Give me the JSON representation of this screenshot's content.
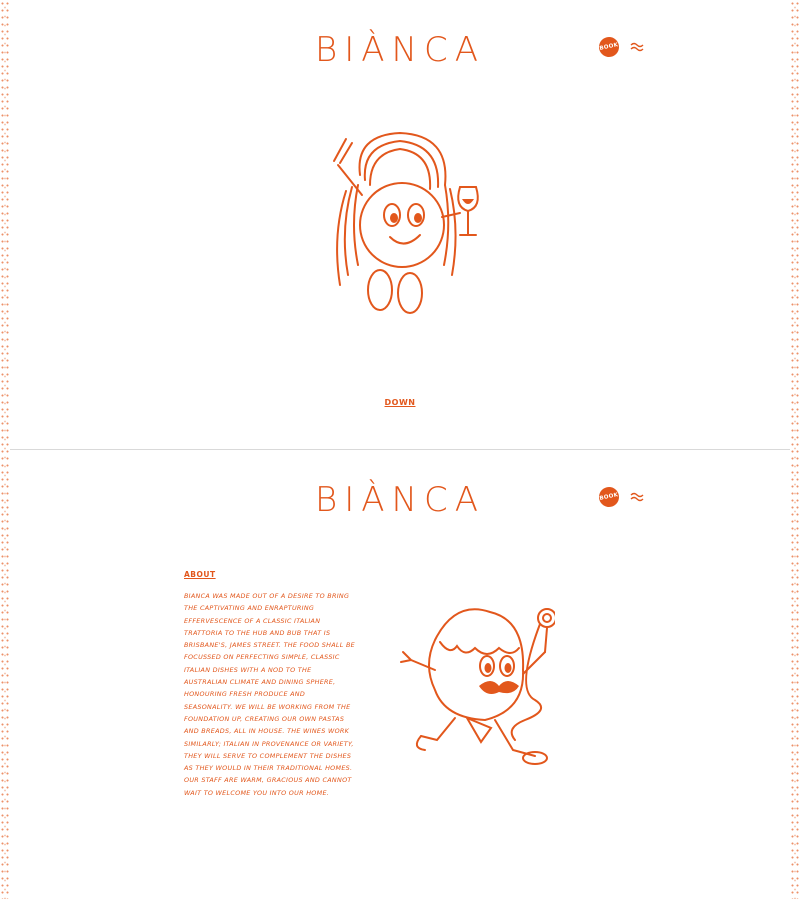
{
  "brand": {
    "logo_text": "BIÀNCA",
    "accent": "#e2571c"
  },
  "header": {
    "book_label": "BOOK",
    "menu_icon": "wave-menu-icon"
  },
  "hero": {
    "down_label": "DOWN",
    "illustration": "spaghetti-character-with-wine"
  },
  "about": {
    "heading": "ABOUT",
    "body": "Bianca was made out of a desire to bring the captivating and enrapturing effervescence of a classic Italian trattoria to the hub and bub that is Brisbane's, James Street. The food shall be focussed on perfecting simple, classic Italian dishes with a nod to the Australian climate and dining sphere, honouring fresh produce and seasonality. We will be working from the foundation up, creating our own pastas and breads, all in house. The wines work similarly; Italian in provenance or variety, they will serve to complement the dishes as they would in their traditional homes. Our staff are warm, gracious and cannot wait to welcome you into our home.",
    "illustration": "meatball-character-with-fork"
  }
}
